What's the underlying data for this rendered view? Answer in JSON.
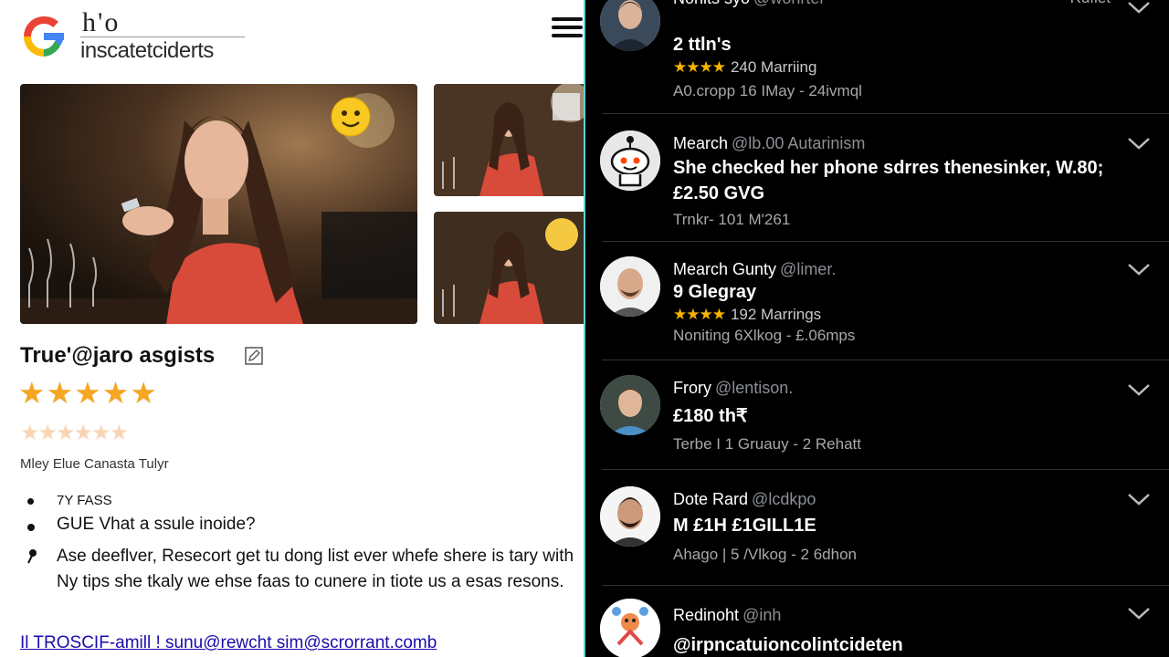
{
  "header": {
    "brand_top": "h'o",
    "brand_name": "inscatetciderts",
    "menu_icon": "hamburger-icon"
  },
  "listing": {
    "title": "True'@jaro asgists",
    "rating_stars": "★★★★★",
    "rating_value": 5,
    "faded_stars": "★★★★★★",
    "location": "Mley Elue Canasta Tulyr",
    "bullets": [
      "7Y FASS",
      "GUE Vhat a ssule inoide?",
      "Ase deeflver, Resecort get tu dong list ever whefe shere is tary with Ny tips she tkaly we ehse faas to cunere in tiote us a esas resons."
    ],
    "footer_link": "Il TROSCIF-amill ! sunu@rewcht sim@scrorrant.comb"
  },
  "feed": {
    "filter_label": "Rdfiet",
    "items": [
      {
        "name": "Nonits syo",
        "handle": "@wonrter",
        "headline": "2 ttln's",
        "subline_stars": "★★★★",
        "subline": "240 Marriing",
        "meta": "A0.cropp 16 IMay - 24ivmql",
        "avatar": "man-portrait-avatar"
      },
      {
        "name": "Mearch",
        "handle": "@lb.00 Autarinism",
        "headline": "She checked her phone sdrres thenesinker, W.80;",
        "headline2": "£2.50 GVG",
        "meta": "Trnkr- 101 M'261",
        "avatar": "reddit-alien-avatar"
      },
      {
        "name": "Mearch Gunty",
        "handle": "@limer.",
        "headline": "9 Glegray",
        "subline_stars": "★★★★",
        "subline": "192 Marrings",
        "meta": "Noniting 6Xlkog - £.06mps",
        "avatar": "bearded-man-avatar"
      },
      {
        "name": "Frory",
        "handle": "@lentison.",
        "headline": "£180 th₹",
        "meta": "Terbe I 1 Gruauy - 2 Rehatt",
        "avatar": "young-man-avatar"
      },
      {
        "name": "Dote Rard",
        "handle": "@lcdkpo",
        "headline": "M £1H £1GILL1E",
        "meta": "Ahago | 5 /Vlkog - 2 6dhon",
        "avatar": "man-beard-avatar"
      },
      {
        "name": "Redinoht",
        "handle": "@inh",
        "headline": "@irpncatuioncolintcideten",
        "avatar": "cartoon-avatar"
      }
    ]
  },
  "colors": {
    "accent_star": "#f5a623",
    "divider": "#5fd3d8",
    "link": "#1a0dab",
    "feed_bg": "#000000"
  }
}
